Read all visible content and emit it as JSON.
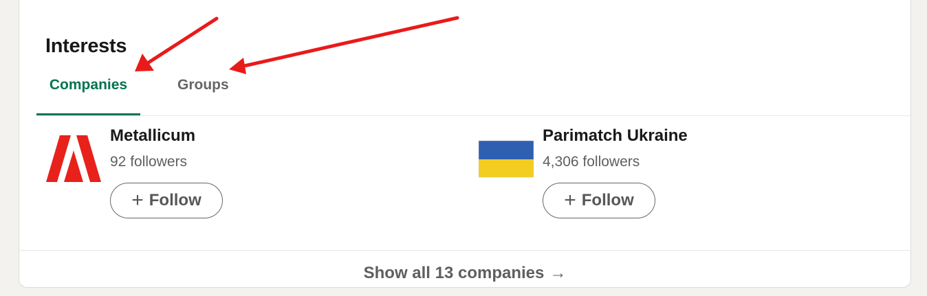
{
  "section": {
    "title": "Interests"
  },
  "tabs": [
    {
      "label": "Companies",
      "active": true
    },
    {
      "label": "Groups",
      "active": false
    }
  ],
  "companies": [
    {
      "name": "Metallicum",
      "followers": "92 followers",
      "follow_label": "Follow",
      "logo": "metallicum-logo-icon"
    },
    {
      "name": "Parimatch Ukraine",
      "followers": "4,306 followers",
      "follow_label": "Follow",
      "logo": "ukraine-flag-icon"
    }
  ],
  "footer": {
    "label": "Show all 13 companies",
    "arrow": "→"
  },
  "colors": {
    "accent": "#01754f",
    "annotation": "#e81b1b",
    "flag_blue": "#2f5fb0",
    "flag_yellow": "#f3cd1f",
    "logo_red": "#e8211b"
  }
}
